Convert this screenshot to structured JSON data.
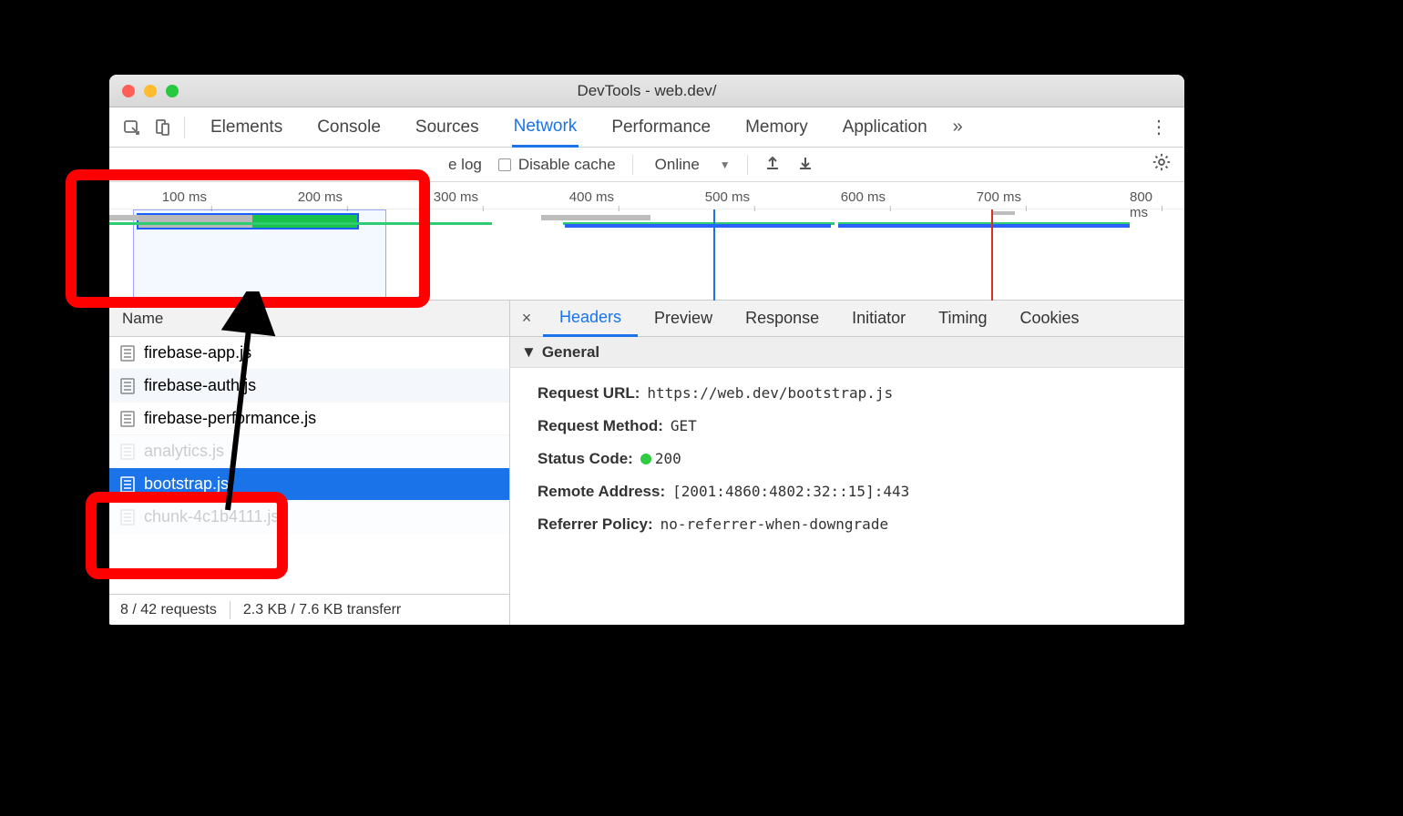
{
  "window": {
    "title": "DevTools - web.dev/"
  },
  "mainTabs": [
    "Elements",
    "Console",
    "Sources",
    "Network",
    "Performance",
    "Memory",
    "Application"
  ],
  "mainTabsActive": "Network",
  "filterBar": {
    "preserveLog": "e log",
    "disableCache": "Disable cache",
    "throttling": "Online"
  },
  "timelineTicks": [
    "100 ms",
    "200 ms",
    "300 ms",
    "400 ms",
    "500 ms",
    "600 ms",
    "700 ms",
    "800 ms"
  ],
  "nameColumn": "Name",
  "requests": [
    {
      "name": "firebase-app.js"
    },
    {
      "name": "firebase-auth.js"
    },
    {
      "name": "firebase-performance.js"
    },
    {
      "name": "analytics.js",
      "hidden": true
    },
    {
      "name": "bootstrap.js",
      "selected": true
    },
    {
      "name": "chunk-4c1b4111.js",
      "hidden": true
    }
  ],
  "statusBar": {
    "requests": "8 / 42 requests",
    "transfer": "2.3 KB / 7.6 KB transferr"
  },
  "detailTabs": [
    "Headers",
    "Preview",
    "Response",
    "Initiator",
    "Timing",
    "Cookies"
  ],
  "detailTabsActive": "Headers",
  "generalSection": "General",
  "headers": {
    "requestUrlLabel": "Request URL:",
    "requestUrl": "https://web.dev/bootstrap.js",
    "requestMethodLabel": "Request Method:",
    "requestMethod": "GET",
    "statusCodeLabel": "Status Code:",
    "statusCode": "200",
    "remoteAddressLabel": "Remote Address:",
    "remoteAddress": "[2001:4860:4802:32::15]:443",
    "referrerPolicyLabel": "Referrer Policy:",
    "referrerPolicy": "no-referrer-when-downgrade"
  }
}
